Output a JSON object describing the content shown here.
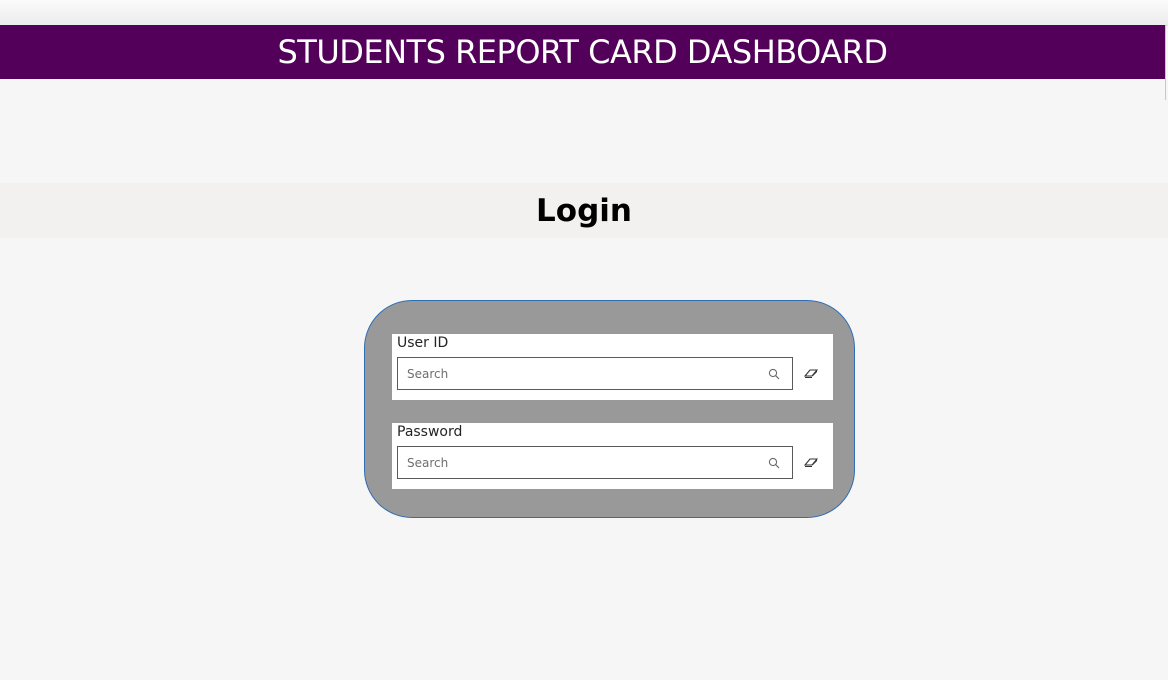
{
  "header": {
    "title": "STUDENTS REPORT CARD DASHBOARD",
    "background_color": "#53005a",
    "text_color": "#ffffff"
  },
  "login": {
    "title": "Login"
  },
  "panel": {
    "background_color": "#999999",
    "border_color": "#2f6eb5",
    "fields": [
      {
        "label": "User ID",
        "placeholder": "Search",
        "value": "",
        "search_icon": "search-icon",
        "clear_icon": "eraser-icon"
      },
      {
        "label": "Password",
        "placeholder": "Search",
        "value": "",
        "search_icon": "search-icon",
        "clear_icon": "eraser-icon"
      }
    ]
  }
}
